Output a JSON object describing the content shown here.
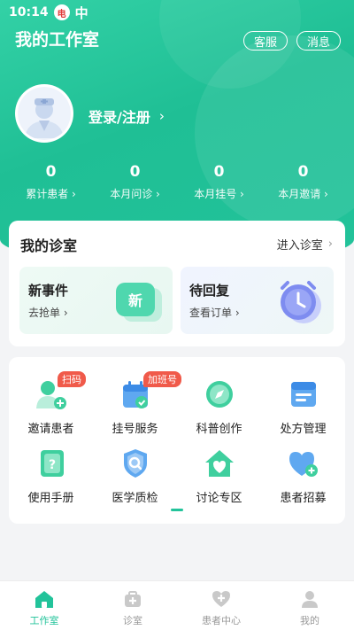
{
  "status": {
    "time": "10:14",
    "badge": "电",
    "glyph": "中"
  },
  "header": {
    "title": "我的工作室",
    "service": "客服",
    "message": "消息"
  },
  "profile": {
    "login": "登录/注册",
    "chev": "›"
  },
  "stats": [
    {
      "value": "0",
      "label": "累计患者 ›"
    },
    {
      "value": "0",
      "label": "本月问诊 ›"
    },
    {
      "value": "0",
      "label": "本月挂号 ›"
    },
    {
      "value": "0",
      "label": "本月邀请 ›"
    }
  ],
  "clinic": {
    "title": "我的诊室",
    "enter": "进入诊室",
    "chev": "›",
    "new_event": {
      "title": "新事件",
      "link": "去抢单 ›",
      "icon_text": "新"
    },
    "pending": {
      "title": "待回复",
      "link": "查看订单 ›"
    }
  },
  "grid": {
    "items": [
      {
        "label": "邀请患者",
        "tag": "扫码",
        "icon": "invite-patient-icon"
      },
      {
        "label": "挂号服务",
        "tag": "加班号",
        "icon": "calendar-icon"
      },
      {
        "label": "科普创作",
        "tag": "",
        "icon": "compass-icon"
      },
      {
        "label": "处方管理",
        "tag": "",
        "icon": "prescription-icon"
      },
      {
        "label": "使用手册",
        "tag": "",
        "icon": "manual-icon"
      },
      {
        "label": "医学质检",
        "tag": "",
        "icon": "shield-search-icon"
      },
      {
        "label": "讨论专区",
        "tag": "",
        "icon": "house-heart-icon"
      },
      {
        "label": "患者招募",
        "tag": "",
        "icon": "heart-plus-icon"
      }
    ]
  },
  "tabs": [
    {
      "label": "工作室",
      "active": true
    },
    {
      "label": "诊室",
      "active": false
    },
    {
      "label": "患者中心",
      "active": false
    },
    {
      "label": "我的",
      "active": false
    }
  ],
  "colors": {
    "primary": "#22c39a",
    "tag": "#f05a4a"
  }
}
